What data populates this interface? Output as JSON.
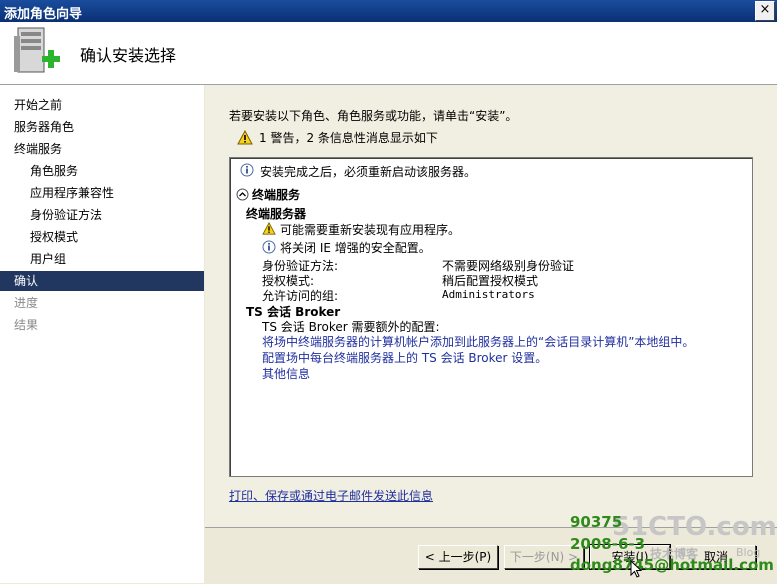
{
  "window": {
    "title": "添加角色向导",
    "close_label": "×"
  },
  "header": {
    "page_title": "确认安装选择"
  },
  "sidebar": {
    "items": [
      {
        "label": "开始之前",
        "level": 0,
        "state": "normal"
      },
      {
        "label": "服务器角色",
        "level": 0,
        "state": "normal"
      },
      {
        "label": "终端服务",
        "level": 0,
        "state": "normal"
      },
      {
        "label": "角色服务",
        "level": 1,
        "state": "normal"
      },
      {
        "label": "应用程序兼容性",
        "level": 1,
        "state": "normal"
      },
      {
        "label": "身份验证方法",
        "level": 1,
        "state": "normal"
      },
      {
        "label": "授权模式",
        "level": 1,
        "state": "normal"
      },
      {
        "label": "用户组",
        "level": 1,
        "state": "normal"
      },
      {
        "label": "确认",
        "level": 0,
        "state": "active"
      },
      {
        "label": "进度",
        "level": 0,
        "state": "disabled"
      },
      {
        "label": "结果",
        "level": 0,
        "state": "disabled"
      }
    ]
  },
  "content": {
    "intro": "若要安装以下角色、角色服务或功能，请单击“安装”。",
    "warning_summary": "1 警告，2 条信息性消息显示如下",
    "restart_note": "安装完成之后，必须重新启动该服务器。",
    "section_title": "终端服务",
    "ts_server_title": "终端服务器",
    "ts_warning": "可能需要重新安装现有应用程序。",
    "ie_note": "将关闭 IE 增强的安全配置。",
    "settings": [
      {
        "label": "身份验证方法:",
        "value": "不需要网络级别身份验证"
      },
      {
        "label": "授权模式:",
        "value": "稍后配置授权模式"
      },
      {
        "label": "允许访问的组:",
        "value": "Administrators"
      }
    ],
    "broker_title": "TS 会话 Broker",
    "broker_note": "TS 会话 Broker 需要额外的配置:",
    "broker_link1": "将场中终端服务器的计算机帐户添加到此服务器上的“会话目录计算机”本地组中。",
    "broker_link2": "配置场中每台终端服务器上的 TS 会话 Broker 设置。",
    "broker_link3": "其他信息",
    "email_link": "打印、保存或通过电子邮件发送此信息"
  },
  "footer": {
    "prev_label": "< 上一步(P)",
    "next_label": "下一步(N) >",
    "install_label": "安装(I)",
    "cancel_label": "取消"
  },
  "watermark": {
    "line1": "90375",
    "line2": "2008-6-3",
    "line3": "dong8745@hotmail.com",
    "brand": "51CTO.com",
    "brand_sub": "技术博客",
    "brand_blog": "Blog"
  }
}
